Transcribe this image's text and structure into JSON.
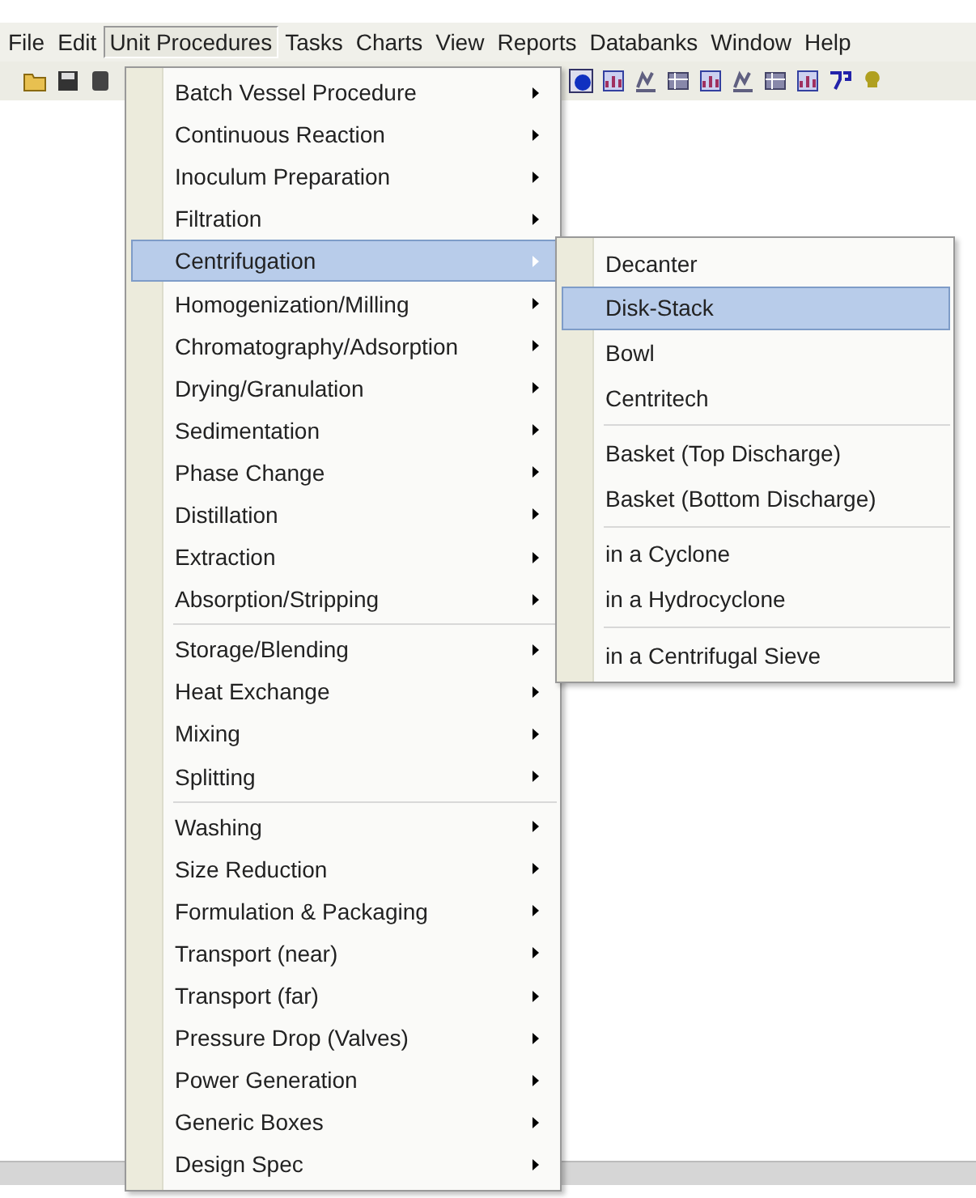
{
  "menu_bar": [
    {
      "label": "File",
      "selected": false
    },
    {
      "label": "Edit",
      "selected": false
    },
    {
      "label": "Unit Procedures",
      "selected": true
    },
    {
      "label": "Tasks",
      "selected": false
    },
    {
      "label": "Charts",
      "selected": false
    },
    {
      "label": "View",
      "selected": false
    },
    {
      "label": "Reports",
      "selected": false
    },
    {
      "label": "Databanks",
      "selected": false
    },
    {
      "label": "Window",
      "selected": false
    },
    {
      "label": "Help",
      "selected": false
    }
  ],
  "menu": {
    "groups": [
      {
        "items": [
          {
            "label": "Batch Vessel Procedure",
            "selected": false,
            "submenu": true
          },
          {
            "label": "Continuous Reaction",
            "selected": false,
            "submenu": true
          },
          {
            "label": "Inoculum Preparation",
            "selected": false,
            "submenu": true
          },
          {
            "label": "Filtration",
            "selected": false,
            "submenu": true
          },
          {
            "label": "Centrifugation",
            "selected": true,
            "submenu": true
          },
          {
            "label": "Homogenization/Milling",
            "selected": false,
            "submenu": true
          },
          {
            "label": "Chromatography/Adsorption",
            "selected": false,
            "submenu": true
          },
          {
            "label": "Drying/Granulation",
            "selected": false,
            "submenu": true
          },
          {
            "label": "Sedimentation",
            "selected": false,
            "submenu": true
          },
          {
            "label": "Phase Change",
            "selected": false,
            "submenu": true
          },
          {
            "label": "Distillation",
            "selected": false,
            "submenu": true
          },
          {
            "label": "Extraction",
            "selected": false,
            "submenu": true
          },
          {
            "label": "Absorption/Stripping",
            "selected": false,
            "submenu": true
          }
        ]
      },
      {
        "items": [
          {
            "label": "Storage/Blending",
            "selected": false,
            "submenu": true
          },
          {
            "label": "Heat Exchange",
            "selected": false,
            "submenu": true
          },
          {
            "label": "Mixing",
            "selected": false,
            "submenu": true
          },
          {
            "label": "Splitting",
            "selected": false,
            "submenu": true
          }
        ]
      },
      {
        "items": [
          {
            "label": "Washing",
            "selected": false,
            "submenu": true
          },
          {
            "label": "Size Reduction",
            "selected": false,
            "submenu": true
          },
          {
            "label": "Formulation & Packaging",
            "selected": false,
            "submenu": true
          },
          {
            "label": "Transport (near)",
            "selected": false,
            "submenu": true
          },
          {
            "label": "Transport (far)",
            "selected": false,
            "submenu": true
          },
          {
            "label": "Pressure Drop (Valves)",
            "selected": false,
            "submenu": true
          },
          {
            "label": "Power Generation",
            "selected": false,
            "submenu": true
          },
          {
            "label": "Generic Boxes",
            "selected": false,
            "submenu": true
          },
          {
            "label": "Design Spec",
            "selected": false,
            "submenu": true
          }
        ]
      }
    ]
  },
  "submenu": {
    "groups": [
      {
        "items": [
          {
            "label": "Decanter",
            "selected": false,
            "submenu": false
          },
          {
            "label": "Disk-Stack",
            "selected": true,
            "submenu": false
          },
          {
            "label": "Bowl",
            "selected": false,
            "submenu": false
          },
          {
            "label": "Centritech",
            "selected": false,
            "submenu": false
          }
        ]
      },
      {
        "items": [
          {
            "label": "Basket (Top Discharge)",
            "selected": false,
            "submenu": false
          },
          {
            "label": "Basket (Bottom Discharge)",
            "selected": false,
            "submenu": false
          }
        ]
      },
      {
        "items": [
          {
            "label": "in a Cyclone",
            "selected": false,
            "submenu": false
          },
          {
            "label": "in a Hydrocyclone",
            "selected": false,
            "submenu": false
          }
        ]
      },
      {
        "items": [
          {
            "label": "in a Centrifugal Sieve",
            "selected": false,
            "submenu": false
          }
        ]
      }
    ]
  }
}
